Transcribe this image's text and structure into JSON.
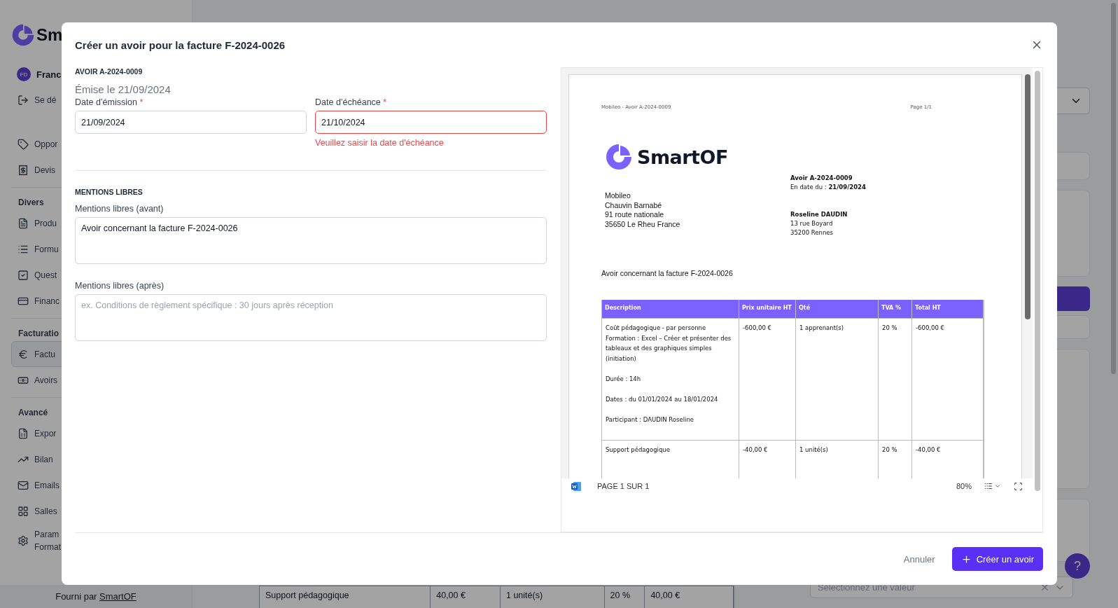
{
  "sidebar": {
    "logo_text": "Sm",
    "user": {
      "initials": "FD",
      "name": "Franc"
    },
    "logout": "Se dé",
    "groups": [
      {
        "items": [
          {
            "label": "Oppor",
            "selected": false
          },
          {
            "label": "Devis",
            "selected": false
          }
        ]
      },
      {
        "title": "Divers",
        "items": [
          {
            "label": "Produ",
            "selected": false
          },
          {
            "label": "Formu",
            "selected": false
          },
          {
            "label": "Quest",
            "selected": false
          },
          {
            "label": "Financ",
            "selected": false
          }
        ]
      },
      {
        "title": "Facturatio",
        "items": [
          {
            "label": "Factu",
            "selected": true
          },
          {
            "label": "Avoirs",
            "selected": false
          }
        ]
      },
      {
        "title": "Avancé",
        "items": [
          {
            "label": "Expor",
            "selected": false
          },
          {
            "label": "Bilan",
            "selected": false
          },
          {
            "label": "Emails",
            "selected": false
          },
          {
            "label": "Salles",
            "selected": false
          },
          {
            "label": "Param\nFormat",
            "selected": false
          }
        ]
      }
    ],
    "footer": {
      "text": "Fourni par",
      "link": "SmartOF"
    }
  },
  "background": {
    "table_row": [
      "Support pédagogique",
      "40,00 €",
      "1 unité(s)",
      "20 %",
      "40,00 €"
    ],
    "select_placeholder": "Sélectionnez une valeur",
    "help": "?"
  },
  "modal": {
    "title": "Créer un avoir pour la facture F-2024-0026",
    "form": {
      "section_title": "AVOIR A-2024-0009",
      "subtitle": "Émise le 21/09/2024",
      "fields": [
        {
          "label": "Date d’émission",
          "required_mark": "*",
          "value": "21/09/2024",
          "invalid": false
        },
        {
          "label": "Date d’échéance",
          "required_mark": "*",
          "value": "21/10/2024",
          "invalid": true,
          "error": "Veuillez saisir la date d'échéance"
        }
      ]
    },
    "mentions": {
      "section_title": "MENTIONS LIBRES",
      "fields": [
        {
          "label": "Mentions libres (avant)",
          "value": "Avoir concernant la facture F-2024-0026"
        },
        {
          "label": "Mentions libres (après)",
          "placeholder": "ex. Conditions de règlement spécifique : 30 jours après réception"
        }
      ]
    },
    "preview": {
      "header_left": "Mobileo - Avoir A-2024-0009",
      "header_right": "Page 1/1",
      "logo_text": "SmartOF",
      "sender": [
        "Mobileo",
        "Chauvin Barnabé",
        "91 route nationale",
        "35650 Le Rheu France"
      ],
      "credit_title": "Avoir A-2024-0009",
      "credit_date": "En date du : **21/09/2024**",
      "recipient_name": "Roseline DAUDIN",
      "recipient": [
        "13 rue Boyard",
        "35200 Rennes"
      ],
      "intro": "Avoir concernant la facture F-2024-0026",
      "table": {
        "columns": [
          "Description",
          "Prix unitaire HT",
          "Qté",
          "TVA %",
          "Total HT"
        ],
        "rows": [
          {
            "cells": [
              "Coût pédagogique - par personne\nFormation : Excel – Créer et présenter des tableaux et des graphiques simples (initiation)\n\nDurée : 14h\n\nDates : du 01/01/2024 au 18/01/2024\n\nParticipant : DAUDIN Roseline",
              "-600,00 €",
              "1 apprenant(s)",
              "20 %",
              "-600,00 €"
            ]
          },
          {
            "cells": [
              "Support pédagogique",
              "-40,00 €",
              "1 unité(s)",
              "20 %",
              "-40,00 €"
            ]
          }
        ]
      },
      "toolbar": {
        "page_label": "PAGE 1 SUR 1",
        "zoom": "80%"
      }
    },
    "buttons": {
      "cancel": "Annuler",
      "submit": "Créer un avoir"
    }
  }
}
